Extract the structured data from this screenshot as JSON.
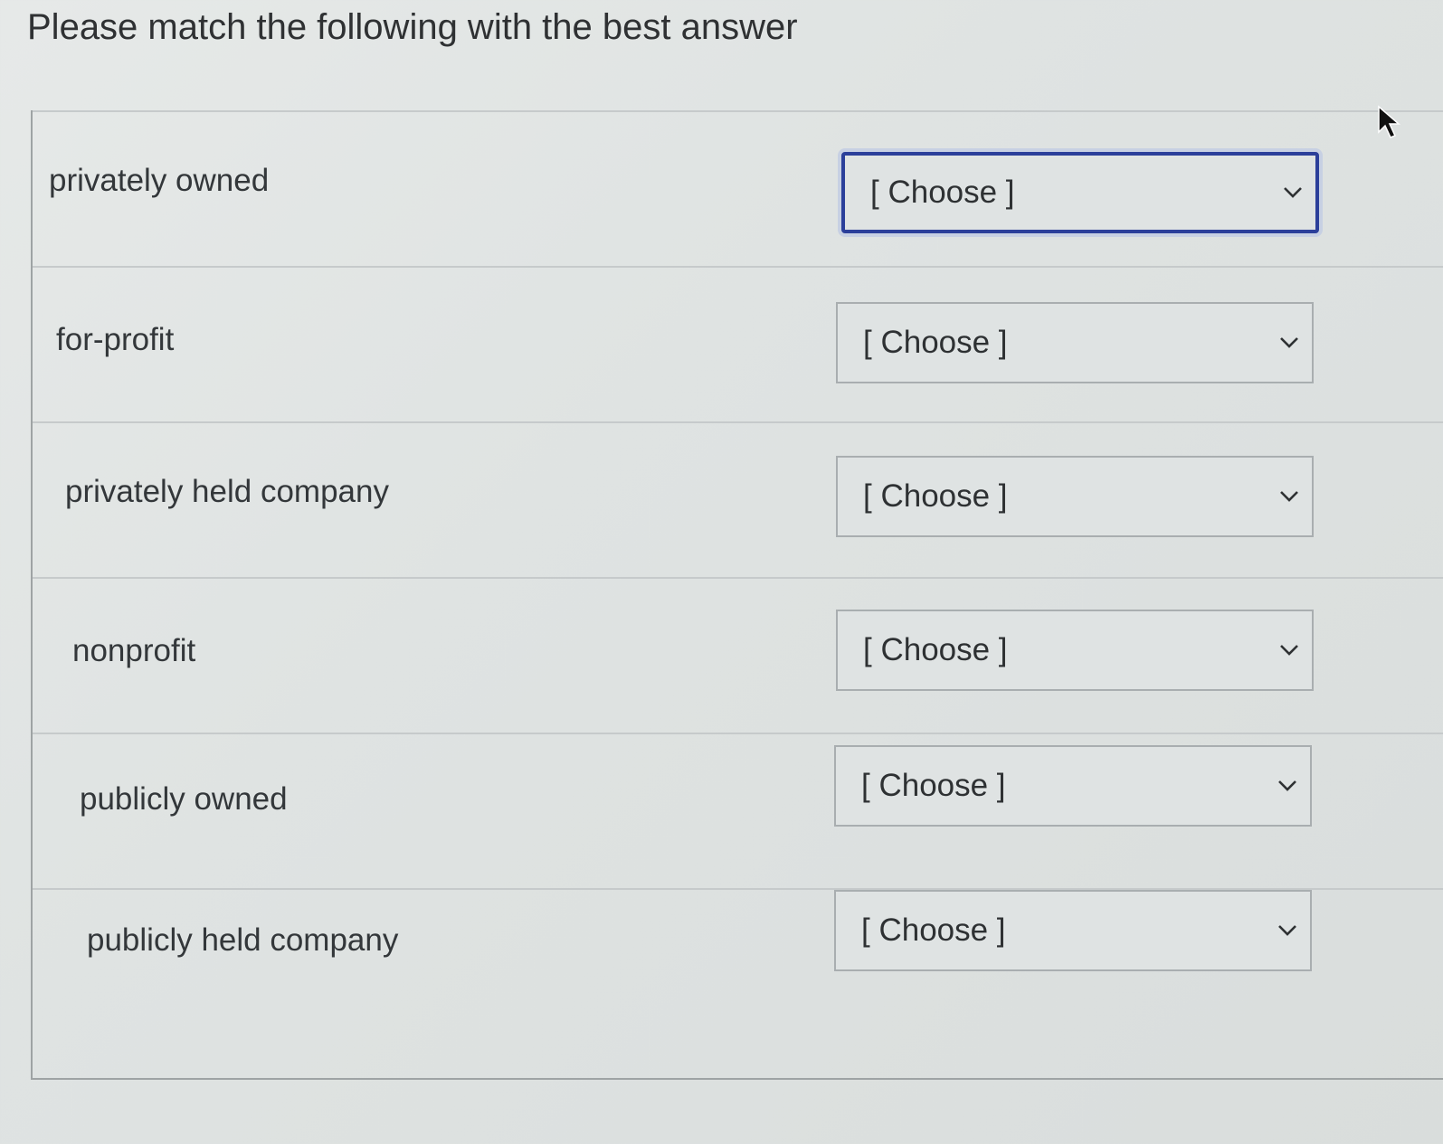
{
  "question": {
    "text": "Please match the following with the best answer"
  },
  "rows": [
    {
      "prompt": "privately owned",
      "selected": "[ Choose ]",
      "focused": true
    },
    {
      "prompt": "for-profit",
      "selected": "[ Choose ]",
      "focused": false
    },
    {
      "prompt": "privately held company",
      "selected": "[ Choose ]",
      "focused": false
    },
    {
      "prompt": "nonprofit",
      "selected": "[ Choose ]",
      "focused": false
    },
    {
      "prompt": "publicly owned",
      "selected": "[ Choose ]",
      "focused": false
    },
    {
      "prompt": "publicly held company",
      "selected": "[ Choose ]",
      "focused": false
    }
  ],
  "icons": {
    "dropdown": "chevron-down-icon",
    "pointer": "mouse-cursor-icon"
  },
  "colors": {
    "focus_border": "#2b3f9a",
    "select_border": "#a9aeb0",
    "text": "#2e3133"
  }
}
